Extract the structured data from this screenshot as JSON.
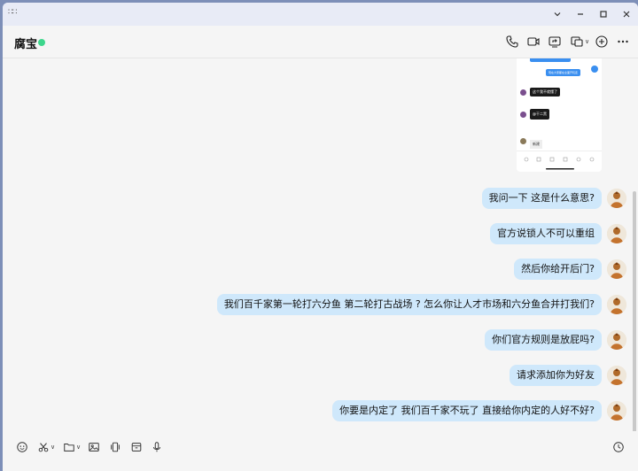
{
  "window": {
    "controls": [
      "chevron-down",
      "minimize",
      "maximize",
      "close"
    ]
  },
  "header": {
    "title": "腐宝",
    "status_color": "#3dd68c",
    "icons": [
      "phone-icon",
      "video-icon",
      "screen-share-icon",
      "remote-assist-icon",
      "add-member-icon",
      "more-icon"
    ]
  },
  "image_message": {
    "blue_1": "",
    "blue_2": "现在大家都在全面开玩走",
    "dark_1": "这个我不就懂了",
    "dark_2": "@干二黑",
    "light_1": "新建"
  },
  "messages": [
    {
      "text": "我问一下 这是什么意思?"
    },
    {
      "text": "官方说锁人不可以重组"
    },
    {
      "text": "然后你给开后门?"
    },
    {
      "text": "我们百千家第一轮打六分鱼 第二轮打古战场 ? 怎么你让人才市场和六分鱼合并打我们?"
    },
    {
      "text": "你们官方规则是放屁吗?"
    },
    {
      "text": "请求添加你为好友"
    },
    {
      "text": "你要是内定了 我们百千家不玩了 直接给你内定的人好不好?"
    }
  ],
  "toolbar": {
    "icons": [
      "emoji-icon",
      "scissors-icon",
      "folder-icon",
      "image-icon",
      "shake-icon",
      "box-icon",
      "mic-icon",
      "history-icon"
    ]
  },
  "colors": {
    "bubble": "#cfe8fb",
    "accent": "#3a8ff0"
  }
}
